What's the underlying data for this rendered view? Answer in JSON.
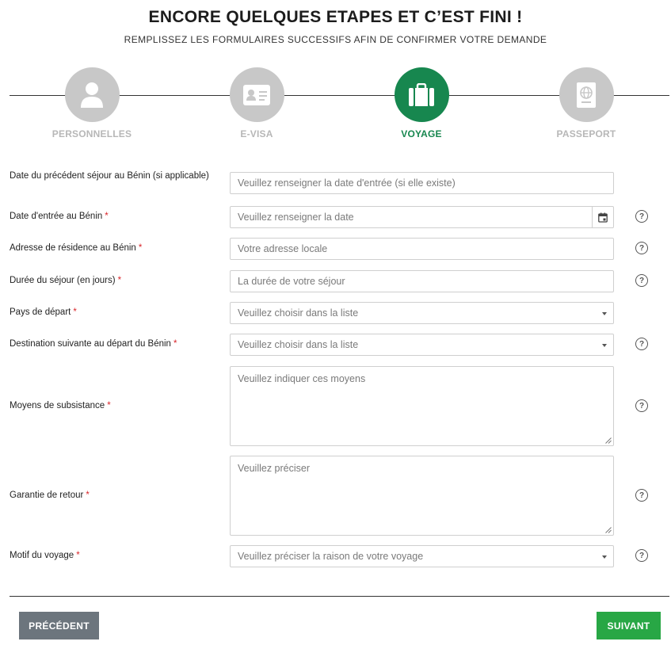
{
  "header": {
    "title": "ENCORE QUELQUES ETAPES ET C’EST FINI !",
    "subtitle": "REMPLISSEZ LES FORMULAIRES SUCCESSIFS AFIN DE CONFIRMER VOTRE DEMANDE"
  },
  "steps": [
    {
      "label": "PERSONNELLES",
      "icon": "user-icon",
      "active": false
    },
    {
      "label": "E-VISA",
      "icon": "id-card-icon",
      "active": false
    },
    {
      "label": "VOYAGE",
      "icon": "suitcase-icon",
      "active": true
    },
    {
      "label": "PASSEPORT",
      "icon": "passport-icon",
      "active": false
    }
  ],
  "colors": {
    "accent": "#17874f",
    "inactive": "#c8c8c8",
    "required": "#d9262b",
    "prev_button": "#6c757d",
    "next_button": "#28a745"
  },
  "form": {
    "required_mark": "*",
    "help_symbol": "?",
    "previous_stay": {
      "label": "Date du précédent séjour au Bénin (si applicable)",
      "placeholder": "Veuillez renseigner la date d'entrée (si elle existe)"
    },
    "entry_date": {
      "label": "Date d'entrée au Bénin",
      "placeholder": "Veuillez renseigner la date"
    },
    "address": {
      "label": "Adresse de résidence au Bénin",
      "placeholder": "Votre adresse locale"
    },
    "duration": {
      "label": "Durée du séjour (en jours)",
      "placeholder": "La durée de votre séjour"
    },
    "departure_country": {
      "label": "Pays de départ",
      "selected": "Veuillez choisir dans la liste"
    },
    "next_destination": {
      "label": "Destination suivante au départ du Bénin",
      "selected": "Veuillez choisir dans la liste"
    },
    "means": {
      "label": "Moyens de subsistance",
      "placeholder": "Veuillez indiquer ces moyens"
    },
    "return_guarantee": {
      "label": "Garantie de retour",
      "placeholder": "Veuillez préciser"
    },
    "purpose": {
      "label": "Motif du voyage",
      "selected": "Veuillez préciser la raison de votre voyage"
    }
  },
  "buttons": {
    "previous": "PRÉCÉDENT",
    "next": "SUIVANT"
  }
}
